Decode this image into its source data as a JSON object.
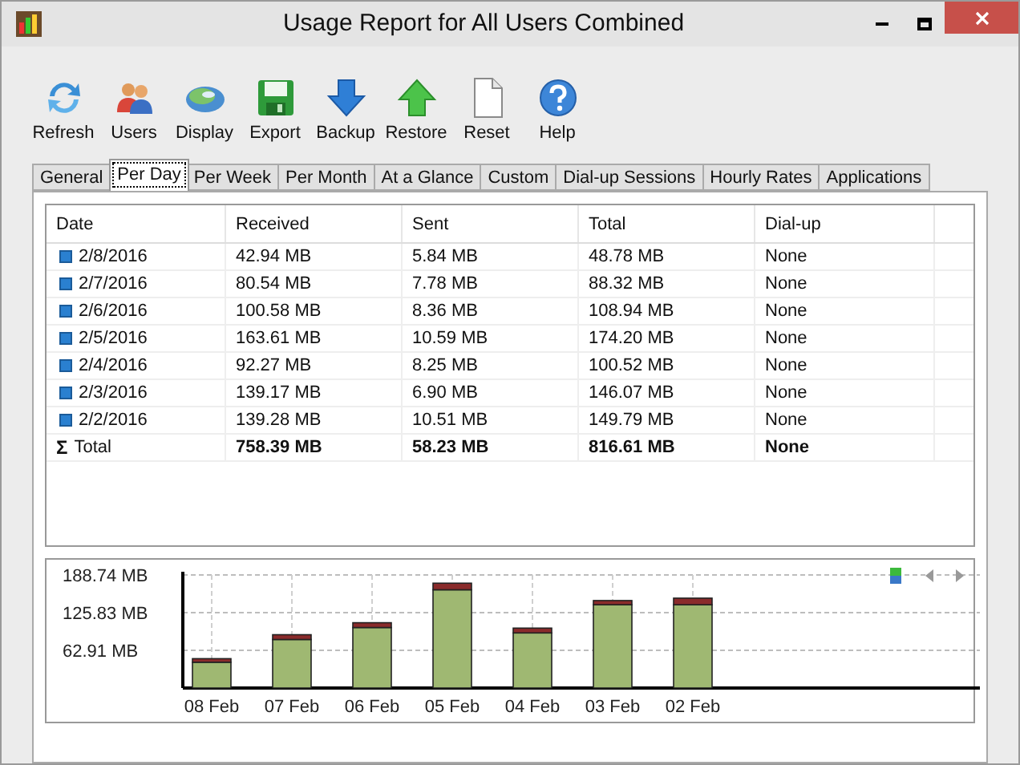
{
  "window": {
    "title": "Usage Report for All Users Combined"
  },
  "toolbar": [
    {
      "kind": "refresh",
      "label": "Refresh"
    },
    {
      "kind": "users",
      "label": "Users"
    },
    {
      "kind": "display",
      "label": "Display"
    },
    {
      "kind": "export",
      "label": "Export"
    },
    {
      "kind": "backup",
      "label": "Backup"
    },
    {
      "kind": "restore",
      "label": "Restore"
    },
    {
      "kind": "reset",
      "label": "Reset"
    },
    {
      "kind": "help",
      "label": "Help"
    }
  ],
  "tabs": [
    {
      "label": "General",
      "selected": false
    },
    {
      "label": "Per Day",
      "selected": true
    },
    {
      "label": "Per Week",
      "selected": false
    },
    {
      "label": "Per Month",
      "selected": false
    },
    {
      "label": "At a Glance",
      "selected": false
    },
    {
      "label": "Custom",
      "selected": false
    },
    {
      "label": "Dial-up Sessions",
      "selected": false
    },
    {
      "label": "Hourly Rates",
      "selected": false
    },
    {
      "label": "Applications",
      "selected": false
    }
  ],
  "table": {
    "columns": [
      "Date",
      "Received",
      "Sent",
      "Total",
      "Dial-up"
    ],
    "rows": [
      {
        "kind": "day",
        "cells": [
          "2/8/2016",
          "42.94 MB",
          "5.84 MB",
          "48.78 MB",
          "None"
        ]
      },
      {
        "kind": "day",
        "cells": [
          "2/7/2016",
          "80.54 MB",
          "7.78 MB",
          "88.32 MB",
          "None"
        ]
      },
      {
        "kind": "day",
        "cells": [
          "2/6/2016",
          "100.58 MB",
          "8.36 MB",
          "108.94 MB",
          "None"
        ]
      },
      {
        "kind": "day",
        "cells": [
          "2/5/2016",
          "163.61 MB",
          "10.59 MB",
          "174.20 MB",
          "None"
        ]
      },
      {
        "kind": "day",
        "cells": [
          "2/4/2016",
          "92.27 MB",
          "8.25 MB",
          "100.52 MB",
          "None"
        ]
      },
      {
        "kind": "day",
        "cells": [
          "2/3/2016",
          "139.17 MB",
          "6.90 MB",
          "146.07 MB",
          "None"
        ]
      },
      {
        "kind": "day",
        "cells": [
          "2/2/2016",
          "139.28 MB",
          "10.51 MB",
          "149.79 MB",
          "None"
        ]
      },
      {
        "kind": "total",
        "icon": "Σ",
        "cells": [
          "Total",
          "758.39 MB",
          "58.23 MB",
          "816.61 MB",
          "None"
        ]
      }
    ]
  },
  "chart": {
    "chart_data": {
      "type": "bar",
      "stacked": true,
      "grid": true,
      "categories": [
        "08 Feb",
        "07 Feb",
        "06 Feb",
        "05 Feb",
        "04 Feb",
        "03 Feb",
        "02 Feb"
      ],
      "series": [
        {
          "color": "#9fb872",
          "values": [
            43,
            81,
            101,
            164,
            92,
            139,
            139
          ]
        },
        {
          "color": "#8a2b2b",
          "values": [
            6,
            8,
            8,
            11,
            8,
            7,
            11
          ]
        }
      ],
      "ylim": [
        0,
        188.74
      ],
      "yticks": [
        {
          "value": 62.91,
          "label": "62.91 MB"
        },
        {
          "value": 125.83,
          "label": "125.83 MB"
        },
        {
          "value": 188.74,
          "label": "188.74 MB"
        }
      ]
    }
  }
}
